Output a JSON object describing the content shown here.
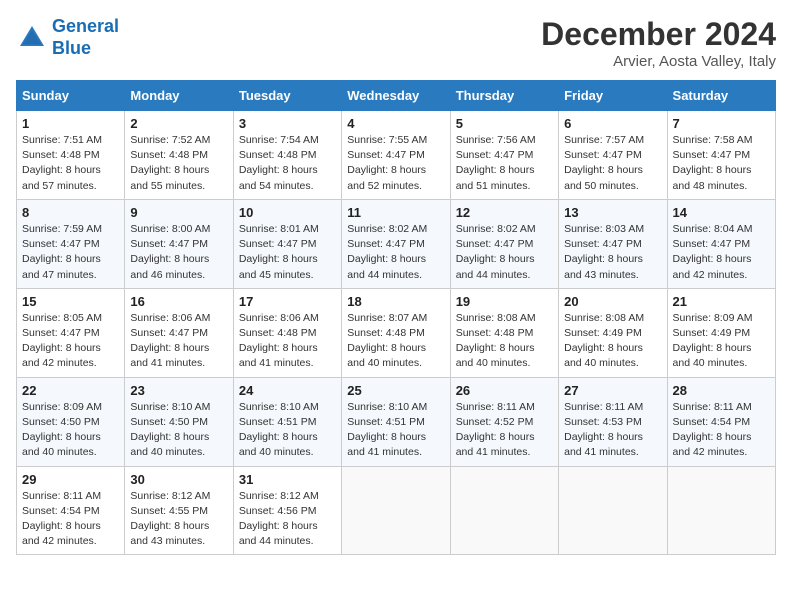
{
  "header": {
    "logo_line1": "General",
    "logo_line2": "Blue",
    "month_title": "December 2024",
    "location": "Arvier, Aosta Valley, Italy"
  },
  "weekdays": [
    "Sunday",
    "Monday",
    "Tuesday",
    "Wednesday",
    "Thursday",
    "Friday",
    "Saturday"
  ],
  "weeks": [
    [
      {
        "day": "1",
        "sunrise": "Sunrise: 7:51 AM",
        "sunset": "Sunset: 4:48 PM",
        "daylight": "Daylight: 8 hours and 57 minutes."
      },
      {
        "day": "2",
        "sunrise": "Sunrise: 7:52 AM",
        "sunset": "Sunset: 4:48 PM",
        "daylight": "Daylight: 8 hours and 55 minutes."
      },
      {
        "day": "3",
        "sunrise": "Sunrise: 7:54 AM",
        "sunset": "Sunset: 4:48 PM",
        "daylight": "Daylight: 8 hours and 54 minutes."
      },
      {
        "day": "4",
        "sunrise": "Sunrise: 7:55 AM",
        "sunset": "Sunset: 4:47 PM",
        "daylight": "Daylight: 8 hours and 52 minutes."
      },
      {
        "day": "5",
        "sunrise": "Sunrise: 7:56 AM",
        "sunset": "Sunset: 4:47 PM",
        "daylight": "Daylight: 8 hours and 51 minutes."
      },
      {
        "day": "6",
        "sunrise": "Sunrise: 7:57 AM",
        "sunset": "Sunset: 4:47 PM",
        "daylight": "Daylight: 8 hours and 50 minutes."
      },
      {
        "day": "7",
        "sunrise": "Sunrise: 7:58 AM",
        "sunset": "Sunset: 4:47 PM",
        "daylight": "Daylight: 8 hours and 48 minutes."
      }
    ],
    [
      {
        "day": "8",
        "sunrise": "Sunrise: 7:59 AM",
        "sunset": "Sunset: 4:47 PM",
        "daylight": "Daylight: 8 hours and 47 minutes."
      },
      {
        "day": "9",
        "sunrise": "Sunrise: 8:00 AM",
        "sunset": "Sunset: 4:47 PM",
        "daylight": "Daylight: 8 hours and 46 minutes."
      },
      {
        "day": "10",
        "sunrise": "Sunrise: 8:01 AM",
        "sunset": "Sunset: 4:47 PM",
        "daylight": "Daylight: 8 hours and 45 minutes."
      },
      {
        "day": "11",
        "sunrise": "Sunrise: 8:02 AM",
        "sunset": "Sunset: 4:47 PM",
        "daylight": "Daylight: 8 hours and 44 minutes."
      },
      {
        "day": "12",
        "sunrise": "Sunrise: 8:02 AM",
        "sunset": "Sunset: 4:47 PM",
        "daylight": "Daylight: 8 hours and 44 minutes."
      },
      {
        "day": "13",
        "sunrise": "Sunrise: 8:03 AM",
        "sunset": "Sunset: 4:47 PM",
        "daylight": "Daylight: 8 hours and 43 minutes."
      },
      {
        "day": "14",
        "sunrise": "Sunrise: 8:04 AM",
        "sunset": "Sunset: 4:47 PM",
        "daylight": "Daylight: 8 hours and 42 minutes."
      }
    ],
    [
      {
        "day": "15",
        "sunrise": "Sunrise: 8:05 AM",
        "sunset": "Sunset: 4:47 PM",
        "daylight": "Daylight: 8 hours and 42 minutes."
      },
      {
        "day": "16",
        "sunrise": "Sunrise: 8:06 AM",
        "sunset": "Sunset: 4:47 PM",
        "daylight": "Daylight: 8 hours and 41 minutes."
      },
      {
        "day": "17",
        "sunrise": "Sunrise: 8:06 AM",
        "sunset": "Sunset: 4:48 PM",
        "daylight": "Daylight: 8 hours and 41 minutes."
      },
      {
        "day": "18",
        "sunrise": "Sunrise: 8:07 AM",
        "sunset": "Sunset: 4:48 PM",
        "daylight": "Daylight: 8 hours and 40 minutes."
      },
      {
        "day": "19",
        "sunrise": "Sunrise: 8:08 AM",
        "sunset": "Sunset: 4:48 PM",
        "daylight": "Daylight: 8 hours and 40 minutes."
      },
      {
        "day": "20",
        "sunrise": "Sunrise: 8:08 AM",
        "sunset": "Sunset: 4:49 PM",
        "daylight": "Daylight: 8 hours and 40 minutes."
      },
      {
        "day": "21",
        "sunrise": "Sunrise: 8:09 AM",
        "sunset": "Sunset: 4:49 PM",
        "daylight": "Daylight: 8 hours and 40 minutes."
      }
    ],
    [
      {
        "day": "22",
        "sunrise": "Sunrise: 8:09 AM",
        "sunset": "Sunset: 4:50 PM",
        "daylight": "Daylight: 8 hours and 40 minutes."
      },
      {
        "day": "23",
        "sunrise": "Sunrise: 8:10 AM",
        "sunset": "Sunset: 4:50 PM",
        "daylight": "Daylight: 8 hours and 40 minutes."
      },
      {
        "day": "24",
        "sunrise": "Sunrise: 8:10 AM",
        "sunset": "Sunset: 4:51 PM",
        "daylight": "Daylight: 8 hours and 40 minutes."
      },
      {
        "day": "25",
        "sunrise": "Sunrise: 8:10 AM",
        "sunset": "Sunset: 4:51 PM",
        "daylight": "Daylight: 8 hours and 41 minutes."
      },
      {
        "day": "26",
        "sunrise": "Sunrise: 8:11 AM",
        "sunset": "Sunset: 4:52 PM",
        "daylight": "Daylight: 8 hours and 41 minutes."
      },
      {
        "day": "27",
        "sunrise": "Sunrise: 8:11 AM",
        "sunset": "Sunset: 4:53 PM",
        "daylight": "Daylight: 8 hours and 41 minutes."
      },
      {
        "day": "28",
        "sunrise": "Sunrise: 8:11 AM",
        "sunset": "Sunset: 4:54 PM",
        "daylight": "Daylight: 8 hours and 42 minutes."
      }
    ],
    [
      {
        "day": "29",
        "sunrise": "Sunrise: 8:11 AM",
        "sunset": "Sunset: 4:54 PM",
        "daylight": "Daylight: 8 hours and 42 minutes."
      },
      {
        "day": "30",
        "sunrise": "Sunrise: 8:12 AM",
        "sunset": "Sunset: 4:55 PM",
        "daylight": "Daylight: 8 hours and 43 minutes."
      },
      {
        "day": "31",
        "sunrise": "Sunrise: 8:12 AM",
        "sunset": "Sunset: 4:56 PM",
        "daylight": "Daylight: 8 hours and 44 minutes."
      },
      null,
      null,
      null,
      null
    ]
  ]
}
